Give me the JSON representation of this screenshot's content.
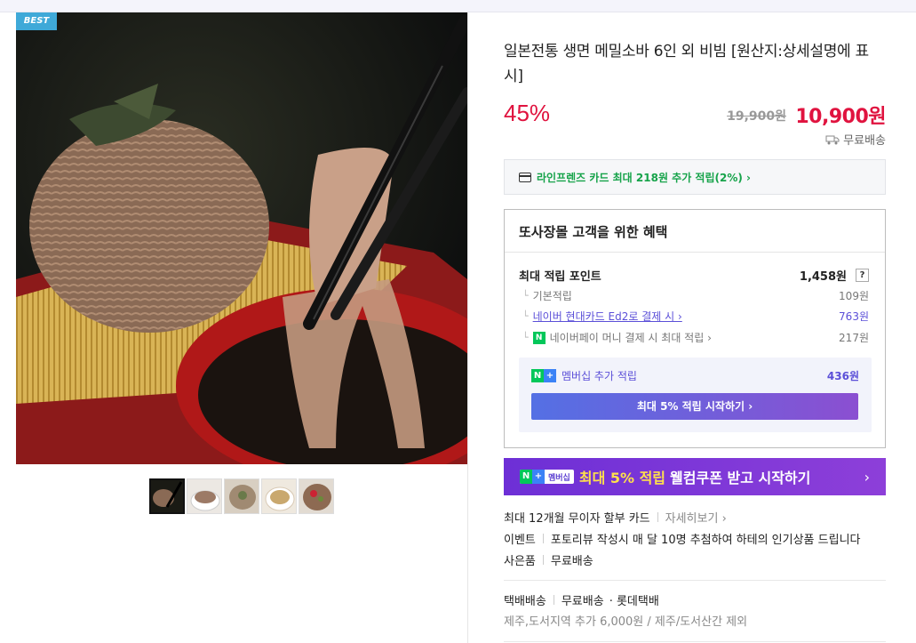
{
  "badge": "BEST",
  "product": {
    "title": "일본전통 생면 메밀소바 6인 외 비빔 [원산지:상세설명에 표시]",
    "discount": "45%",
    "original_price": "19,900원",
    "price": "10,900원",
    "shipping": "무료배송"
  },
  "card_benefit": "라인프렌즈 카드 최대 218원 추가 적립(2%) ›",
  "benefits": {
    "title": "또사장몰 고객을 위한 혜택",
    "max_point_label": "최대 적립 포인트",
    "max_point_value": "1,458원",
    "help": "?",
    "rows": [
      {
        "label": "기본적립",
        "value": "109원"
      },
      {
        "label": "네이버 현대카드 Ed2로 결제 시 ›",
        "value": "763원"
      },
      {
        "label": "네이버페이 머니 결제 시 최대 적립 ›",
        "value": "217원"
      }
    ],
    "npay_icon": "N",
    "membership_label": "멤버십 추가 적립",
    "membership_value": "436원",
    "membership_button": "최대 5% 적립 시작하기 ›"
  },
  "banner": {
    "tag_text": "멤버십",
    "highlight": "최대 5% 적립",
    "rest": "웰컴쿠폰 받고 시작하기",
    "arrow": "›"
  },
  "installment": {
    "text": "최대 12개월 무이자 할부 카드",
    "link": "자세히보기 ›"
  },
  "event": {
    "label": "이벤트",
    "text": "포토리뷰 작성시 매 달 10명 추첨하여 하테의 인기상품 드립니다"
  },
  "gift": {
    "label": "사은품",
    "text": "무료배송"
  },
  "delivery": {
    "label": "택배배송",
    "fee": "무료배송",
    "carrier": "· 롯데택배",
    "extra": "제주,도서지역 추가 6,000원 / 제주/도서산간 제외"
  },
  "colors": {
    "price": "#e0133f",
    "accent": "#5b4fd8",
    "npay": "#03c75a"
  }
}
